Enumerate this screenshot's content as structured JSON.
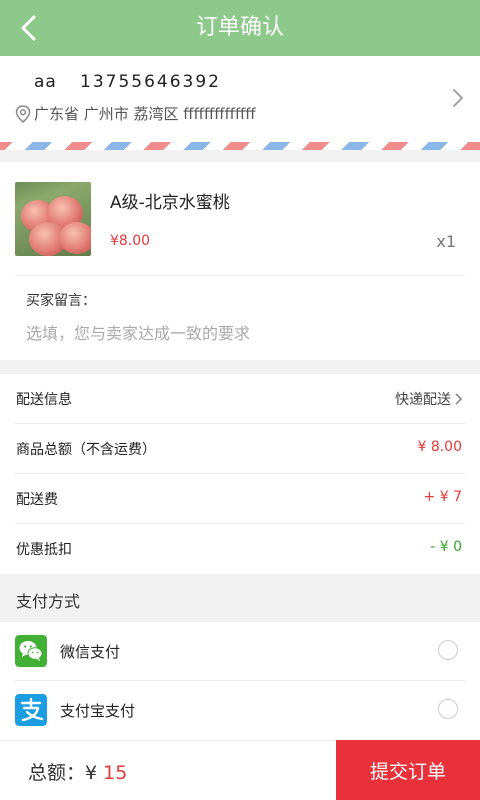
{
  "header": {
    "title": "订单确认"
  },
  "address": {
    "name": "aa",
    "phone": "13755646392",
    "line": "广东省 广州市 荔湾区 ffffffffffffff"
  },
  "product": {
    "name": "A级-北京水蜜桃",
    "price": "¥8.00",
    "quantity": "x1"
  },
  "message": {
    "label": "买家留言：",
    "placeholder": "选填，您与卖家达成一致的要求"
  },
  "info": {
    "delivery_label": "配送信息",
    "delivery_value": "快递配送",
    "subtotal_label": "商品总额（不含运费）",
    "subtotal_value": "¥ 8.00",
    "shipping_label": "配送费",
    "shipping_value": "+ ¥ 7",
    "discount_label": "优惠抵扣",
    "discount_value": "- ¥ 0"
  },
  "payment": {
    "title": "支付方式",
    "methods": [
      {
        "label": "微信支付",
        "icon": "wechat-pay-icon",
        "color": "#41b035"
      },
      {
        "label": "支付宝支付",
        "icon": "alipay-icon",
        "color": "#1a9de1"
      }
    ]
  },
  "footer": {
    "total_label": "总额：¥",
    "total_value": "15",
    "submit_label": "提交订单"
  },
  "colors": {
    "header_bg": "#8cc98a",
    "accent_red": "#e43a3a",
    "discount_green": "#3aa12f",
    "submit_bg": "#e8313a"
  }
}
